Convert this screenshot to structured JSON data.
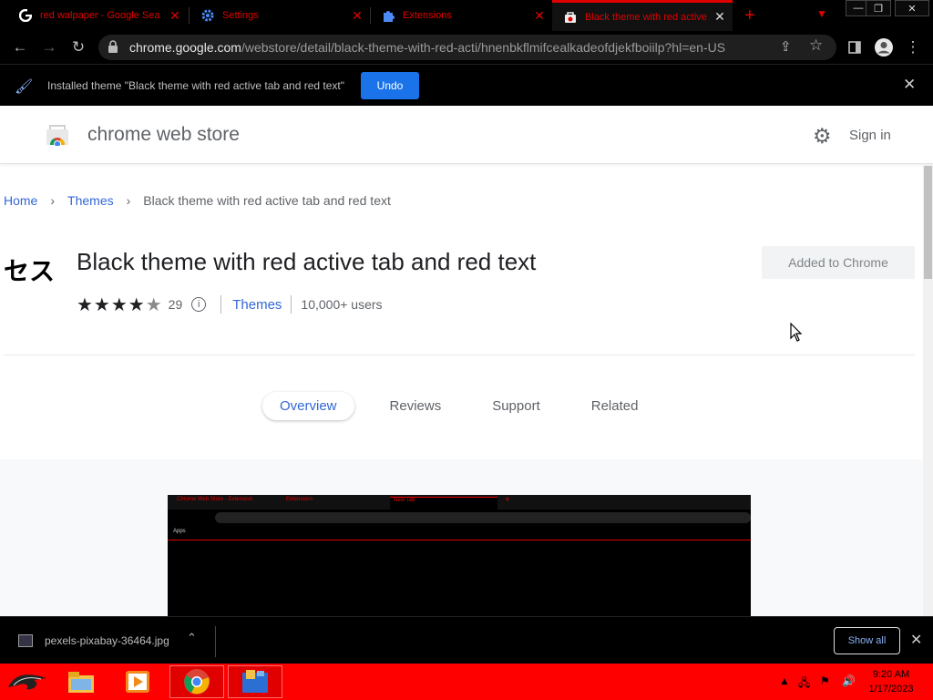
{
  "browser": {
    "tabs": [
      {
        "title": "red walpaper - Google Sea",
        "icon": "google-icon"
      },
      {
        "title": "Settings",
        "icon": "gear-icon"
      },
      {
        "title": "Extensions",
        "icon": "puzzle-icon"
      },
      {
        "title": "Black theme with red active",
        "icon": "webstore-icon",
        "active": true
      }
    ],
    "new_tab": "+",
    "url_host": "chrome.google.com",
    "url_path": "/webstore/detail/black-theme-with-red-acti/hnenbkflmifcealkadeofdjekfboiilp?hl=en-US",
    "accent_color": "#e00000"
  },
  "infobar": {
    "message": "Installed theme \"Black theme with red active tab and red text\"",
    "undo_label": "Undo"
  },
  "webstore": {
    "brand": "chrome web store",
    "sign_in": "Sign in",
    "breadcrumb": [
      "Home",
      "Themes",
      "Black theme with red active tab and red text"
    ],
    "extension_icon_text": "セス",
    "title": "Black theme with red active tab and red text",
    "rating": 4.5,
    "rating_count": "29",
    "category": "Themes",
    "users": "10,000+ users",
    "added_label": "Added to Chrome",
    "detail_tabs": [
      "Overview",
      "Reviews",
      "Support",
      "Related"
    ],
    "active_tab": "Overview",
    "preview": {
      "tabs": [
        "Chrome Web Store - Extension",
        "Extensions",
        "New Tab"
      ],
      "bookmark": "Apps"
    }
  },
  "downloads": {
    "filename": "pexels-pixabay-36464.jpg",
    "show_all": "Show all"
  },
  "taskbar": {
    "time": "9:20 AM",
    "date": "1/17/2023",
    "color": "#ff0000"
  }
}
